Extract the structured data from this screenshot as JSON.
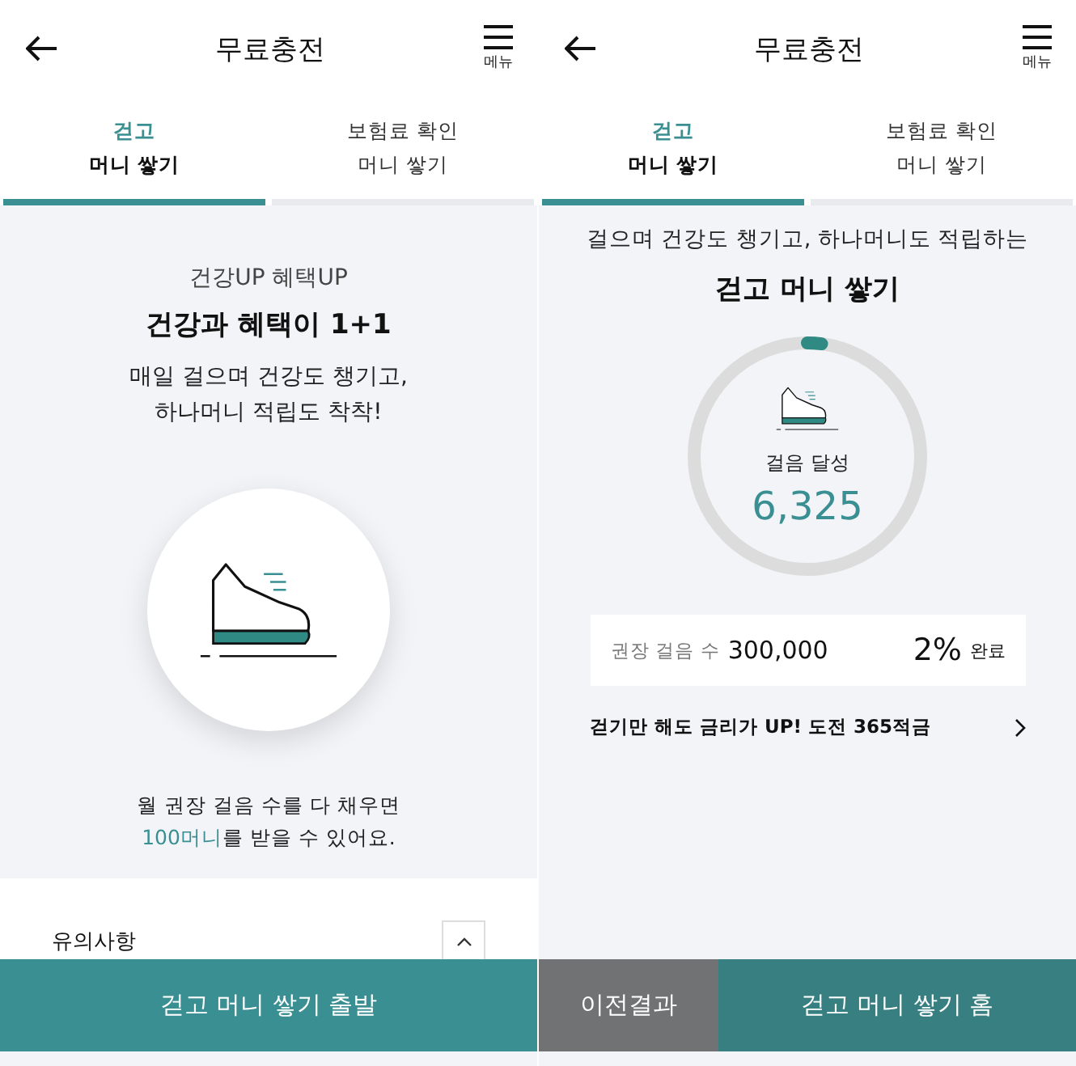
{
  "left_screen": {
    "header": {
      "title": "무료충전",
      "menu_label": "메뉴"
    },
    "tabs": [
      {
        "line1": "걷고",
        "line2": "머니 쌓기",
        "selected": true
      },
      {
        "line1": "보험료 확인",
        "line2": "머니 쌓기",
        "selected": false
      }
    ],
    "kicker": "건강UP 혜택UP",
    "headline": "건강과 혜택이 1+1",
    "body_lines": [
      "매일 걸으며 건강도 챙기고,",
      "하나머니 적립도 착착!"
    ],
    "note": {
      "line1": "월 권장 걸음 수를 다 채우면",
      "highlight": "100머니",
      "rest": "를 받을 수 있어요."
    },
    "notice_title": "유의사항",
    "button": "걷고 머니 쌓기 출발"
  },
  "right_screen": {
    "header": {
      "title": "무료충전",
      "menu_label": "메뉴"
    },
    "tabs": [
      {
        "line1": "걷고",
        "line2": "머니 쌓기",
        "selected": true
      },
      {
        "line1": "보험료 확인",
        "line2": "머니 쌓기",
        "selected": false
      }
    ],
    "subtitle": "걸으며 건강도 챙기고, 하나머니도 적립하는",
    "title": "걷고 머니 쌓기",
    "progress": {
      "level": 0.02,
      "label": "걸음 달성",
      "steps": "6,325"
    },
    "goal": {
      "label": "권장 걸음 수",
      "value": "300,000",
      "percent": "2%",
      "suffix": "완료"
    },
    "link": "걷기만 해도 금리가 UP! 도전 365적금",
    "buttons": [
      {
        "label": "이전결과",
        "kind": "secondary"
      },
      {
        "label": "걷고 머니 쌓기 홈",
        "kind": "primary"
      }
    ]
  }
}
